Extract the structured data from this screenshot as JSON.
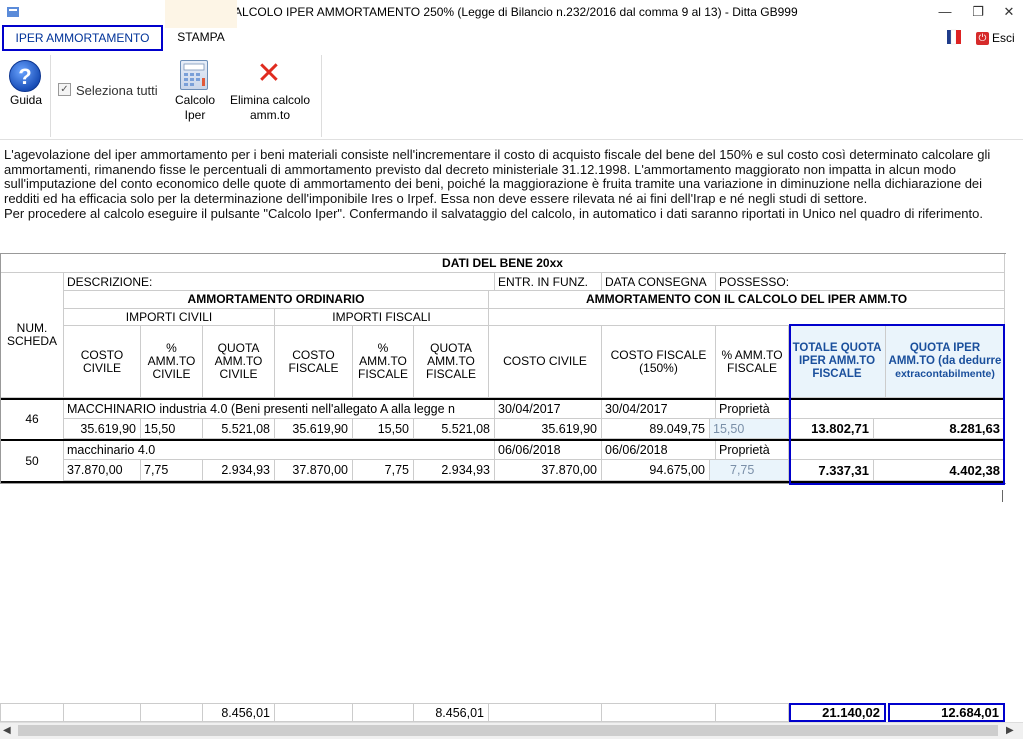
{
  "window": {
    "title": "CALCOLO IPER AMMORTAMENTO 250% (Legge di Bilancio n.232/2016 dal comma 9 al 13) - Ditta GB999",
    "minimize_glyph": "—",
    "maximize_glyph": "❐",
    "close_glyph": "✕"
  },
  "tabs": [
    {
      "label": "IPER AMMORTAMENTO"
    },
    {
      "label": "STAMPA"
    }
  ],
  "esci_label": "Esci",
  "ribbon": {
    "guida_label": "Guida",
    "select_all_label": "Seleziona tutti",
    "calc_label_1": "Calcolo",
    "calc_label_2": "Iper",
    "delete_label_1": "Elimina calcolo",
    "delete_label_2": "amm.to"
  },
  "info_text": [
    "L'agevolazione del iper ammortamento per i beni materiali consiste nell'incrementare il costo di acquisto fiscale del bene del 150% e sul costo così determinato calcolare gli ammortamenti, rimanendo fisse le percentuali di ammortamento previsto dal decreto ministeriale 31.12.1998. L'ammortamento maggiorato non impatta in alcun modo sull'imputazione del conto economico delle quote di ammortamento dei beni, poiché la maggiorazione è fruita tramite una variazione in diminuzione nella dichiarazione dei redditi ed ha efficacia solo per la determinazione dell'imponibile Ires o Irpef. Essa non deve essere rilevata né ai fini dell'Irap e né negli studi di settore.",
    "Per procedere al calcolo eseguire il pulsante \"Calcolo Iper\". Confermando il salvataggio del calcolo, in automatico i dati saranno riportati in Unico nel quadro di riferimento."
  ],
  "grid": {
    "header_title": "DATI DEL BENE 20xx",
    "num_scheda": "NUM. SCHEDA",
    "descrizione": "DESCRIZIONE:",
    "entr_funz": "ENTR. IN FUNZ.",
    "data_consegna": "DATA CONSEGNA",
    "possesso": "POSSESSO:",
    "amm_ordinario": "AMMORTAMENTO ORDINARIO",
    "amm_iper": "AMMORTAMENTO CON IL CALCOLO DEL IPER AMM.TO",
    "importi_civili": "IMPORTI CIVILI",
    "importi_fiscali": "IMPORTI FISCALI",
    "col_costo_civile": "COSTO CIVILE",
    "col_pct_civile": "% AMM.TO CIVILE",
    "col_quota_civile": "QUOTA AMM.TO CIVILE",
    "col_costo_fiscale": "COSTO FISCALE",
    "col_pct_fiscale": "% AMM.TO FISCALE",
    "col_quota_fiscale": "QUOTA AMM.TO FISCALE",
    "col_iper_costo_civile": "COSTO CIVILE",
    "col_iper_costo_fiscale": "COSTO FISCALE (150%)",
    "col_iper_pct": "% AMM.TO FISCALE",
    "col_totale_quota": "TOTALE QUOTA IPER AMM.TO FISCALE",
    "col_quota_iper": "QUOTA IPER AMM.TO (da dedurre",
    "col_quota_iper_2": "extracontabilmente)"
  },
  "rows": [
    {
      "scheda": "46",
      "descrizione": "MACCHINARIO industria 4.0 (Beni presenti nell'allegato A alla legge n",
      "entr_funz": "30/04/2017",
      "data_consegna": "30/04/2017",
      "possesso": "Proprietà",
      "costo_civile": "35.619,90",
      "pct_civile": "15,50",
      "quota_civile": "5.521,08",
      "costo_fiscale": "35.619,90",
      "pct_fiscale": "15,50",
      "quota_fiscale": "5.521,08",
      "iper_costo_civile": "35.619,90",
      "iper_costo_fiscale": "89.049,75",
      "iper_pct": "15,50",
      "totale_quota": "13.802,71",
      "quota_iper": "8.281,63"
    },
    {
      "scheda": "50",
      "descrizione": "macchinario 4.0",
      "entr_funz": "06/06/2018",
      "data_consegna": "06/06/2018",
      "possesso": "Proprietà",
      "costo_civile": "37.870,00",
      "pct_civile": "7,75",
      "quota_civile": "2.934,93",
      "costo_fiscale": "37.870,00",
      "pct_fiscale": "7,75",
      "quota_fiscale": "2.934,93",
      "iper_costo_civile": "37.870,00",
      "iper_costo_fiscale": "94.675,00",
      "iper_pct": "7,75",
      "totale_quota": "7.337,31",
      "quota_iper": "4.402,38"
    }
  ],
  "totals": {
    "quota_civile": "8.456,01",
    "quota_fiscale": "8.456,01",
    "totale_quota": "21.140,02",
    "quota_iper": "12.684,01"
  },
  "colors": {
    "accent_border": "#0000cc",
    "light_blue_cell": "#eaf4fb",
    "tab_hover": "#fdf5e6"
  }
}
